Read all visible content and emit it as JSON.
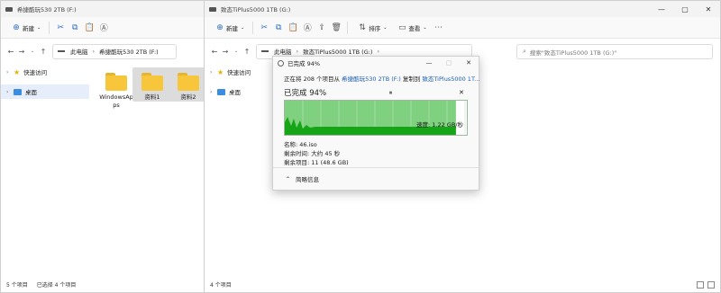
{
  "left_window": {
    "title": "希捷酷玩530 2TB (F:)",
    "toolbar": {
      "new_label": "新建"
    },
    "breadcrumb": [
      "此电脑",
      "希捷酷玩530 2TB (F:)"
    ],
    "sidebar": [
      {
        "label": "快速访问",
        "icon": "star-icon"
      },
      {
        "label": "桌面",
        "icon": "desktop-icon"
      }
    ],
    "files": [
      {
        "name": "WindowsApps",
        "selected": false
      },
      {
        "name": "资料1",
        "selected": true
      },
      {
        "name": "资料2",
        "selected": true
      }
    ],
    "status": {
      "count": "5 个项目",
      "selected": "已选择 4 个项目"
    }
  },
  "right_window": {
    "title": "致态TiPlus5000 1TB (G:)",
    "toolbar": {
      "new_label": "新建",
      "sort_label": "排序",
      "view_label": "查看"
    },
    "breadcrumb": [
      "此电脑",
      "致态TiPlus5000 1TB (G:)"
    ],
    "search_placeholder": "搜索\"致态TiPlus5000 1TB (G:)\"",
    "sidebar": [
      {
        "label": "快速访问",
        "icon": "star-icon"
      },
      {
        "label": "桌面",
        "icon": "desktop-icon"
      }
    ],
    "status": {
      "count": "4 个项目"
    }
  },
  "copy_dialog": {
    "title": "已完成 94%",
    "line_prefix": "正在将 208 个项目从",
    "source": "希捷酷玩530 2TB (F:)",
    "line_mid": "复制到",
    "destination": "致态TiPlus5000 1T...",
    "percent_text": "已完成 94%",
    "progress": 0.94,
    "speed": "速度: 1.22 GB/秒",
    "name": "名称: 46.iso",
    "time_left": "剩余时间: 大约 45 秒",
    "items_left": "剩余项目: 11 (48.6 GB)",
    "less_details": "简略信息",
    "colors": {
      "graph_fill": "#7fd07f",
      "graph_dark": "#16a516",
      "link": "#1a5fb4"
    }
  }
}
